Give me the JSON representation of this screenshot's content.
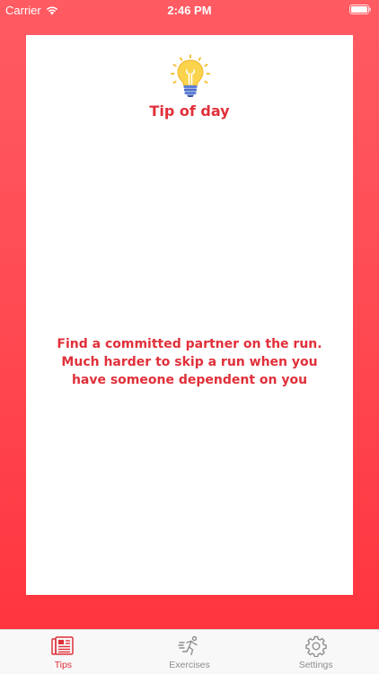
{
  "status_bar": {
    "carrier": "Carrier",
    "time": "2:46 PM"
  },
  "card": {
    "title": "Tip of day",
    "tip": "Find a committed partner on the run. Much harder to skip a run when you have someone dependent on you",
    "icon": "lightbulb-icon"
  },
  "tabs": [
    {
      "label": "Tips",
      "icon": "newspaper-icon",
      "active": true
    },
    {
      "label": "Exercises",
      "icon": "runner-icon",
      "active": false
    },
    {
      "label": "Settings",
      "icon": "gear-icon",
      "active": false
    }
  ],
  "colors": {
    "background_top": "#ff5b63",
    "background_bottom": "#ff353f",
    "accent": "#e0303a",
    "inactive": "#8e8e93"
  }
}
